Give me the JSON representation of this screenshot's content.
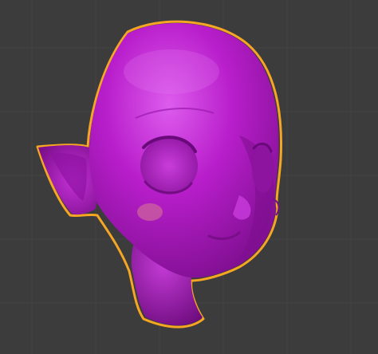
{
  "viewport": {
    "background_color": "#3c3c3c",
    "grid_major_color": "#4a4a4a",
    "grid_minor_color": "#424242"
  },
  "model": {
    "name_icon": "sculpted-head-mesh",
    "base_color": "#b21bc4",
    "highlight_color": "#d04be0",
    "shadow_color": "#7a0e8a",
    "selection_outline_color": "#f5a623",
    "cheek_blush_color": "#c85aa0",
    "selected": true
  }
}
